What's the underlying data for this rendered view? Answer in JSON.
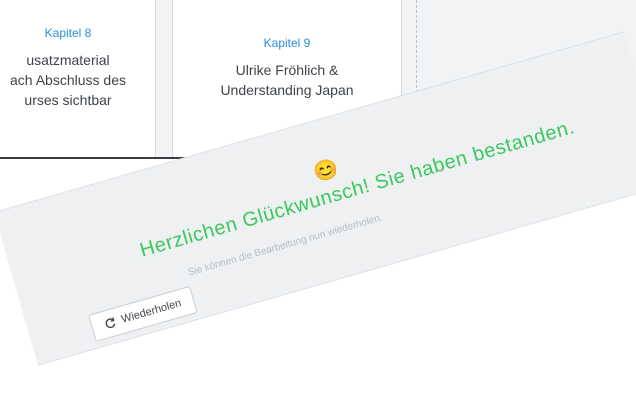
{
  "cards": [
    {
      "chapter": "Kapitel 8",
      "text": "usatzmaterial\nach Abschluss des\nurses sichtbar"
    },
    {
      "chapter": "Kapitel 9",
      "text": "Ulrike Fröhlich &\nUnderstanding Japan"
    }
  ],
  "result": {
    "emoji": "😊",
    "headline": "Herzlichen Glückwunsch! Sie haben bestanden.",
    "subtext": "Sie können die Bearbeitung nun wiederholen.",
    "repeat_label": "Wiederholen"
  },
  "colors": {
    "success": "#3bc85f",
    "chapter": "#2a8fd8"
  }
}
